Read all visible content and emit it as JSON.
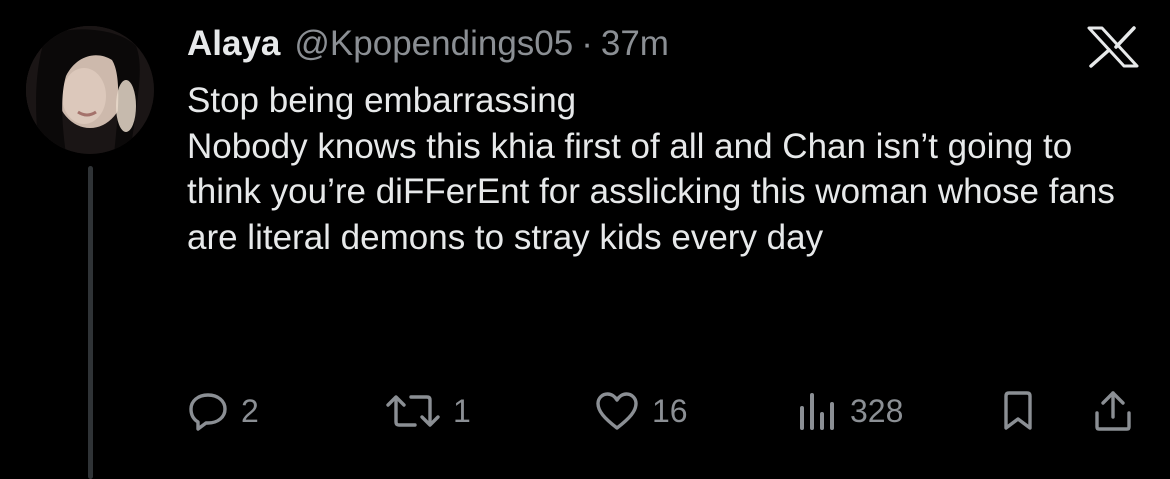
{
  "post": {
    "author_name": "Alaya",
    "author_handle": "@Kpopendings05",
    "separator": "·",
    "timestamp": "37m",
    "text_lines": [
      "Stop being embarrassing",
      "Nobody knows this khia first of all and Chan isn’t going to think you’re diFFerEnt for asslicking this woman whose fans are literal demons to stray kids every day"
    ]
  },
  "actions": {
    "replies": "2",
    "reposts": "1",
    "likes": "16",
    "views": "328"
  },
  "icons": {
    "brand": "x-logo-icon",
    "reply": "reply-icon",
    "repost": "repost-icon",
    "like": "heart-icon",
    "views": "views-icon",
    "bookmark": "bookmark-icon",
    "share": "share-icon"
  },
  "colors": {
    "background": "#000000",
    "text": "#e7e9ea",
    "secondary": "#8b8f94"
  }
}
